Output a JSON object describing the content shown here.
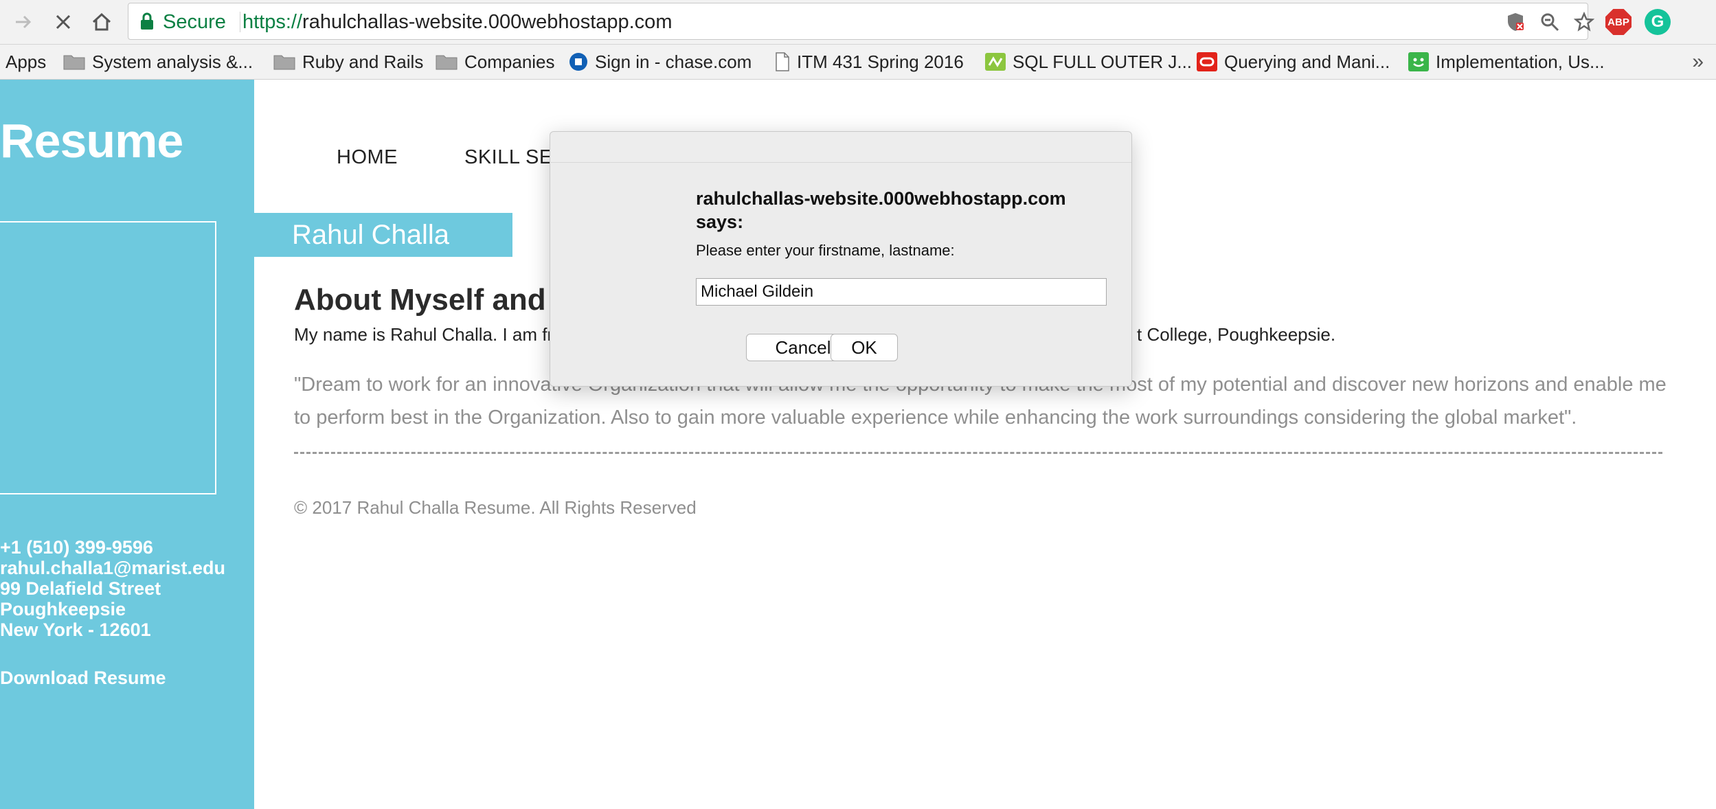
{
  "browser": {
    "secure_label": "Secure",
    "url_scheme": "https://",
    "url_host": "rahulchallas-website.000webhostapp.com",
    "abp_label": "ABP",
    "grammarly_label": "G",
    "bookmarks": [
      {
        "label": "Apps",
        "icon": "apps-grid-icon"
      },
      {
        "label": "System analysis &...",
        "icon": "folder-icon"
      },
      {
        "label": "Ruby and Rails",
        "icon": "folder-icon"
      },
      {
        "label": "Companies",
        "icon": "folder-icon"
      },
      {
        "label": "Sign in - chase.com",
        "icon": "chase-logo-icon"
      },
      {
        "label": "ITM 431 Spring 2016",
        "icon": "page-icon"
      },
      {
        "label": "SQL FULL OUTER J...",
        "icon": "sql-site-icon"
      },
      {
        "label": "Querying and Mani...",
        "icon": "oracle-icon"
      },
      {
        "label": "Implementation, Us...",
        "icon": "smiley-site-icon"
      }
    ],
    "more_bookmarks": "»"
  },
  "sidebar": {
    "brand": "Resume",
    "contact": {
      "phone": "+1 (510) 399-9596",
      "email": "rahul.challa1@marist.edu",
      "street": "99 Delafield Street",
      "city": "Poughkeepsie",
      "state_zip": "New York - 12601"
    },
    "download": "Download Resume"
  },
  "nav": {
    "home": "HOME",
    "skill_partial": "SKILL SE"
  },
  "main": {
    "name_banner": "Rahul Challa",
    "section_title": "About Myself and",
    "intro_visible_start": "My name is Rahul Challa. I am fr",
    "intro_visible_end": "t College, Poughkeepsie.",
    "quote": "\"Dream to work for an innovative Organization that will allow me the opportunity to make the most of my potential and discover new horizons and enable me to perform best in the Organization. Also to gain more valuable experience while enhancing the work surroundings considering the global market\".",
    "footer": "© 2017 Rahul Challa Resume. All Rights Reserved"
  },
  "dialog": {
    "origin_line1": "rahulchallas-website.000webhostapp.com",
    "origin_line2": "says:",
    "message": "Please enter your firstname, lastname:",
    "input_value": "Michael Gildein",
    "cancel": "Cancel",
    "ok": "OK"
  },
  "colors": {
    "accent": "#6ec9de",
    "secure_green": "#0b8043",
    "abp_red": "#d9302c",
    "grammarly_green": "#15c39a"
  }
}
